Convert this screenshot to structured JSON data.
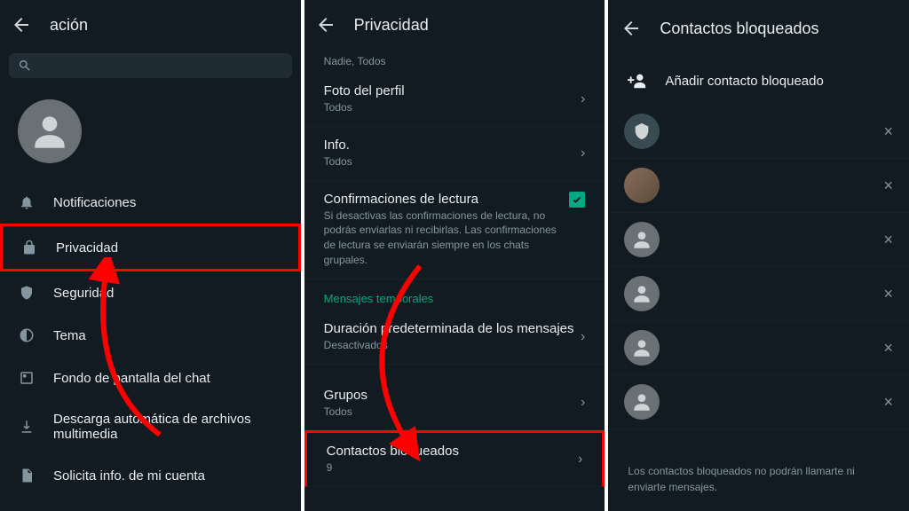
{
  "panel1": {
    "title": "ación",
    "search_placeholder": "",
    "menu": {
      "notifications": "Notificaciones",
      "privacy": "Privacidad",
      "security": "Seguridad",
      "theme": "Tema",
      "wallpaper": "Fondo de pantalla del chat",
      "media_download": "Descarga automática de archivos multimedia",
      "request_info": "Solicita info. de mi cuenta"
    }
  },
  "panel2": {
    "title": "Privacidad",
    "top_sub": "Nadie, Todos",
    "profile_photo": {
      "title": "Foto del perfil",
      "sub": "Todos"
    },
    "info": {
      "title": "Info.",
      "sub": "Todos"
    },
    "read_receipts": {
      "title": "Confirmaciones de lectura",
      "sub": "Si desactivas las confirmaciones de lectura, no podrás enviarlas ni recibirlas. Las confirmaciones de lectura se enviarán siempre en los chats grupales."
    },
    "section_temp": "Mensajes temporales",
    "default_duration": {
      "title": "Duración predeterminada de los mensajes",
      "sub": "Desactivados"
    },
    "groups": {
      "title": "Grupos",
      "sub": "Todos"
    },
    "blocked": {
      "title": "Contactos bloqueados",
      "sub": "9"
    }
  },
  "panel3": {
    "title": "Contactos bloqueados",
    "add_label": "Añadir contacto bloqueado",
    "footer": "Los contactos bloqueados no podrán llamarte ni enviarte mensajes."
  }
}
